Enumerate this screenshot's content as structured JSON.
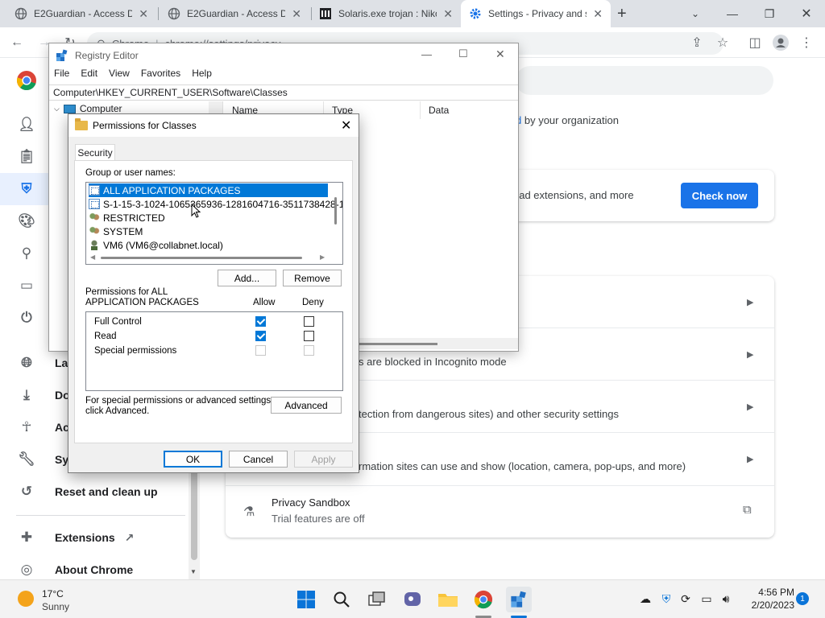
{
  "browser": {
    "tabs": [
      {
        "title": "E2Guardian - Access De",
        "active": false
      },
      {
        "title": "E2Guardian - Access De",
        "active": false
      },
      {
        "title": "Solaris.exe trojan : Niko",
        "active": false
      },
      {
        "title": "Settings - Privacy and s",
        "active": true
      }
    ],
    "new_tab": "+",
    "omnibox": {
      "chip": "Chrome",
      "url": "chrome://settings/privacy"
    }
  },
  "settings": {
    "nav": [
      {
        "label": "You and Google",
        "icon": "person-icon",
        "visible_label": ""
      },
      {
        "label": "Autofill",
        "icon": "clipboard-icon",
        "visible_label": ""
      },
      {
        "label": "Privacy and security",
        "icon": "shield-icon",
        "visible_label": "",
        "active": true
      },
      {
        "label": "Appearance",
        "icon": "palette-icon",
        "visible_label": ""
      },
      {
        "label": "Search engine",
        "icon": "search-icon",
        "visible_label": ""
      },
      {
        "label": "Default browser",
        "icon": "browser-icon",
        "visible_label": ""
      },
      {
        "label": "On startup",
        "icon": "power-icon",
        "visible_label": ""
      },
      {
        "label": "Lar",
        "icon": "globe-icon",
        "visible_label": "Lar"
      },
      {
        "label": "Dov",
        "icon": "download-icon",
        "visible_label": "Dov"
      },
      {
        "label": "Acc",
        "icon": "accessibility-icon",
        "visible_label": "Acc"
      },
      {
        "label": "Sys",
        "icon": "wrench-icon",
        "visible_label": "Sys"
      },
      {
        "label": "Reset and clean up",
        "icon": "history-icon",
        "visible_label": "Reset and clean up"
      },
      {
        "label": "Extensions",
        "icon": "puzzle-icon",
        "visible_label": "Extensions"
      },
      {
        "label": "About Chrome",
        "icon": "chrome-icon",
        "visible_label": "About Chrome"
      }
    ],
    "managed_text": "by your organization",
    "safety_text": "oad extensions, and more",
    "check_now": "Check now",
    "incognito_text": "s are blocked in Incognito mode",
    "security_text": "tection from dangerous sites) and other security settings",
    "site_settings_text": "rmation sites can use and show (location, camera, pop-ups, and more)",
    "privacy_sandbox_title": "Privacy Sandbox",
    "privacy_sandbox_sub": "Trial features are off"
  },
  "regedit": {
    "title": "Registry Editor",
    "menu": [
      "File",
      "Edit",
      "View",
      "Favorites",
      "Help"
    ],
    "address": "Computer\\HKEY_CURRENT_USER\\Software\\Classes",
    "tree_root": "Computer",
    "columns": [
      "Name",
      "Type",
      "Data"
    ]
  },
  "permissions": {
    "title": "Permissions for Classes",
    "tab": "Security",
    "group_label": "Group or user names:",
    "users": [
      {
        "name": "ALL APPLICATION PACKAGES",
        "icon": "package-icon",
        "selected": true
      },
      {
        "name": "S-1-15-3-1024-1065365936-1281604716-3511738428-165",
        "icon": "package-icon",
        "selected": false
      },
      {
        "name": "RESTRICTED",
        "icon": "group-icon",
        "selected": false
      },
      {
        "name": "SYSTEM",
        "icon": "group-icon",
        "selected": false
      },
      {
        "name": "VM6 (VM6@collabnet.local)",
        "icon": "user-icon",
        "selected": false
      }
    ],
    "add_button": "Add...",
    "remove_button": "Remove",
    "perm_for_line1": "Permissions for ALL",
    "perm_for_line2": "APPLICATION PACKAGES",
    "allow_header": "Allow",
    "deny_header": "Deny",
    "rows": [
      {
        "name": "Full Control",
        "allow": true,
        "deny": false,
        "disabled": false
      },
      {
        "name": "Read",
        "allow": true,
        "deny": false,
        "disabled": false
      },
      {
        "name": "Special permissions",
        "allow": false,
        "deny": false,
        "disabled": true
      }
    ],
    "advanced_note_line1": "For special permissions or advanced settings,",
    "advanced_note_line2": "click Advanced.",
    "advanced_button": "Advanced",
    "ok": "OK",
    "cancel": "Cancel",
    "apply": "Apply"
  },
  "taskbar": {
    "weather_temp": "17°C",
    "weather_desc": "Sunny",
    "time": "4:56 PM",
    "date": "2/20/2023",
    "notifications": "1"
  }
}
